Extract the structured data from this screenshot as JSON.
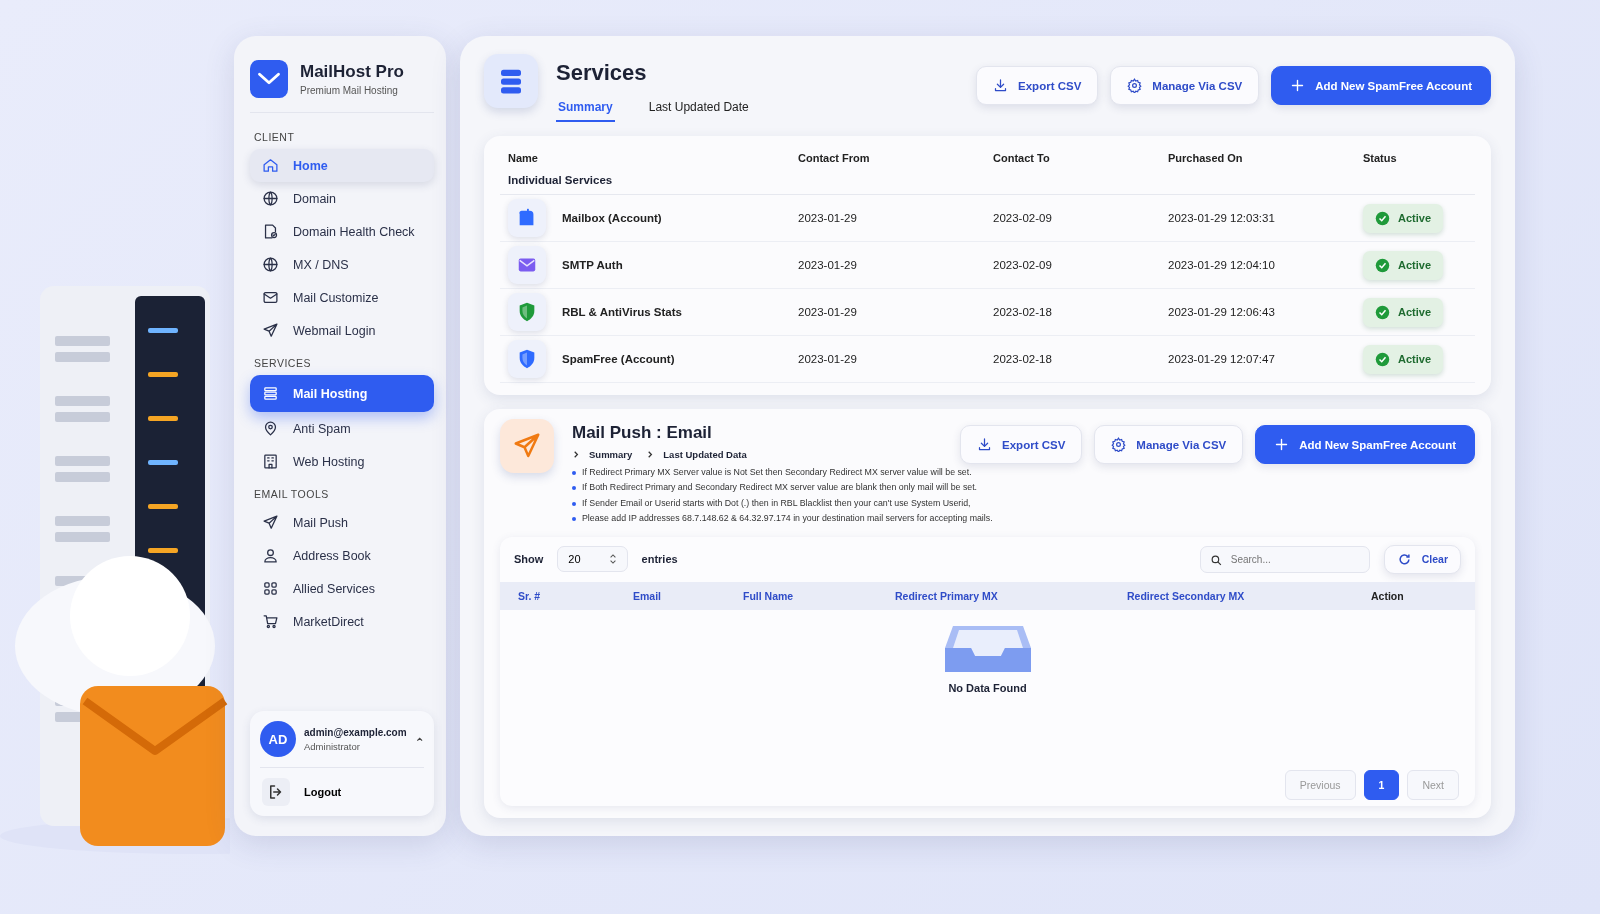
{
  "brand": {
    "name": "MailHost Pro",
    "tagline": "Premium Mail Hosting"
  },
  "sidebar": {
    "sections": [
      {
        "title": "CLIENT",
        "items": [
          {
            "label": "Home",
            "kind": "home",
            "selected": false,
            "raised": true
          },
          {
            "label": "Domain",
            "kind": "globe",
            "selected": false,
            "raised": false
          },
          {
            "label": "Domain Health Check",
            "kind": "check",
            "selected": false,
            "raised": false
          },
          {
            "label": "MX / DNS",
            "kind": "globe",
            "selected": false,
            "raised": false
          },
          {
            "label": "Mail Customize",
            "kind": "mail",
            "selected": false,
            "raised": false
          },
          {
            "label": "Webmail Login",
            "kind": "send",
            "selected": false,
            "raised": false
          }
        ]
      },
      {
        "title": "SERVICES",
        "items": [
          {
            "label": "Mail Hosting",
            "kind": "server",
            "selected": true,
            "raised": false
          },
          {
            "label": "Anti Spam",
            "kind": "pin",
            "selected": false,
            "raised": false
          },
          {
            "label": "Web Hosting",
            "kind": "building",
            "selected": false,
            "raised": false
          }
        ]
      },
      {
        "title": "EMAIL TOOLS",
        "items": [
          {
            "label": "Mail Push",
            "kind": "send",
            "selected": false,
            "raised": false
          },
          {
            "label": "Address Book",
            "kind": "person",
            "selected": false,
            "raised": false
          },
          {
            "label": "Allied Services",
            "kind": "grid",
            "selected": false,
            "raised": false
          },
          {
            "label": "MarketDirect",
            "kind": "cart",
            "selected": false,
            "raised": false
          }
        ]
      }
    ]
  },
  "user": {
    "initials": "AD",
    "email": "admin@example.com",
    "role": "Administrator",
    "logout": "Logout"
  },
  "services": {
    "title": "Services",
    "tabs": [
      {
        "label": "Summary",
        "selected": true
      },
      {
        "label": "Last Updated Date",
        "selected": false
      }
    ],
    "buttons": [
      {
        "label": "Export CSV",
        "kind": "download"
      },
      {
        "label": "Manage Via CSV",
        "kind": "gear"
      },
      {
        "label": "Add New SpamFree Account",
        "kind": "add"
      }
    ],
    "columns": [
      "Name",
      "Contact From",
      "Contact To",
      "Purchased On",
      "Status"
    ],
    "group_label": "Individual Services",
    "rows": [
      {
        "name": "Mailbox (Account)",
        "kind": "mailbox",
        "color": "#2f6bff",
        "contact_from": "2023-01-29",
        "contact_to": "2023-02-09",
        "purchased_on": "2023-01-29 12:03:31",
        "status": "Active"
      },
      {
        "name": "SMTP Auth",
        "kind": "envelope",
        "color": "#7b5cf0",
        "contact_from": "2023-01-29",
        "contact_to": "2023-02-09",
        "purchased_on": "2023-01-29 12:04:10",
        "status": "Active"
      },
      {
        "name": "RBL & AntiVirus Stats",
        "kind": "shield",
        "color": "#1f9a3a",
        "contact_from": "2023-01-29",
        "contact_to": "2023-02-18",
        "purchased_on": "2023-01-29 12:06:43",
        "status": "Active"
      },
      {
        "name": "SpamFree (Account)",
        "kind": "shield",
        "color": "#2f6bff",
        "contact_from": "2023-01-29",
        "contact_to": "2023-02-18",
        "purchased_on": "2023-01-29 12:07:47",
        "status": "Active"
      }
    ]
  },
  "mail_push": {
    "title": "Mail Push : Email",
    "breadcrumbs": [
      "Summary",
      "Last Updated Data"
    ],
    "notes": [
      "If Redirect Primary MX Server value is Not Set then Secondary Redirect MX server value will be set.",
      "If Both Redirect Primary and Secondary Redirect MX server value are blank then only mail will be set.",
      "If Sender Email or Userid starts with Dot (.) then in RBL Blacklist then your can't use System Userid,",
      "Please add IP addresses 68.7.148.62 & 64.32.97.174 in your destination mail servers for accepting mails."
    ],
    "buttons": [
      {
        "label": "Export CSV",
        "kind": "download"
      },
      {
        "label": "Manage Via CSV",
        "kind": "gear"
      },
      {
        "label": "Add New SpamFree Account",
        "kind": "add"
      }
    ],
    "show_label": "Show",
    "entries_value": "20",
    "entries_label": "entries",
    "search": {
      "placeholder": "Search..."
    },
    "clear": "Clear",
    "columns": [
      "Sr. #",
      "Email",
      "Full Name",
      "Redirect Primary MX",
      "Redirect Secondary MX",
      "Action"
    ],
    "empty_text": "No Data Found",
    "pagination": [
      {
        "label": "Previous",
        "disabled": true,
        "selected": false
      },
      {
        "label": "1",
        "disabled": false,
        "selected": true
      },
      {
        "label": "Next",
        "disabled": true,
        "selected": false
      }
    ]
  }
}
